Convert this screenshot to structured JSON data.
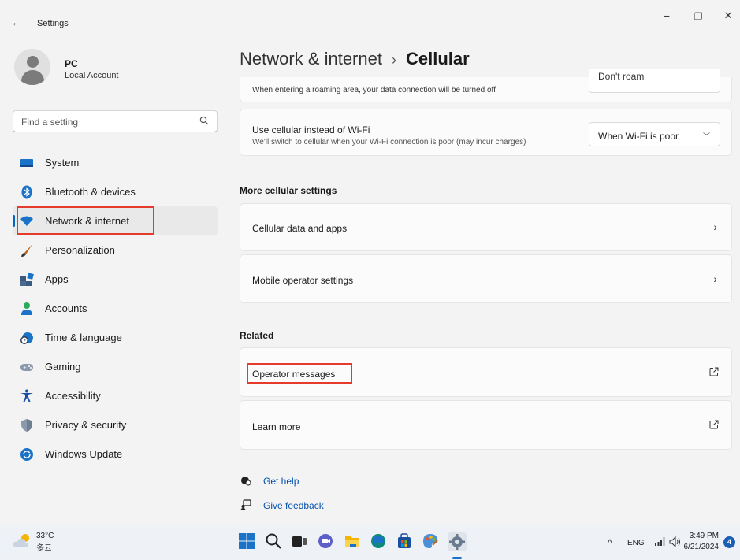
{
  "window": {
    "title": "Settings",
    "back_glyph": "←",
    "minimize_glyph": "−",
    "restore_glyph": "❐",
    "close_glyph": "✕"
  },
  "user": {
    "name": "PC",
    "account_type": "Local Account"
  },
  "search": {
    "placeholder": "Find a setting"
  },
  "sidebar": {
    "items": [
      {
        "label": "System",
        "icon": "system-icon"
      },
      {
        "label": "Bluetooth & devices",
        "icon": "bluetooth-icon"
      },
      {
        "label": "Network & internet",
        "icon": "wifi-icon",
        "active": true
      },
      {
        "label": "Personalization",
        "icon": "brush-icon"
      },
      {
        "label": "Apps",
        "icon": "apps-icon"
      },
      {
        "label": "Accounts",
        "icon": "accounts-icon"
      },
      {
        "label": "Time & language",
        "icon": "globe-clock-icon"
      },
      {
        "label": "Gaming",
        "icon": "gamepad-icon"
      },
      {
        "label": "Accessibility",
        "icon": "accessibility-icon"
      },
      {
        "label": "Privacy & security",
        "icon": "shield-icon"
      },
      {
        "label": "Windows Update",
        "icon": "update-icon"
      }
    ]
  },
  "header": {
    "breadcrumb_parent": "Network & internet",
    "separator": "›",
    "current": "Cellular"
  },
  "roaming": {
    "description": "When entering a roaming area, your data connection will be turned off",
    "value": "Don't roam"
  },
  "cellular_wifi": {
    "label": "Use cellular instead of Wi-Fi",
    "description": "We'll switch to cellular when your Wi-Fi connection is poor (may incur charges)",
    "value": "When Wi-Fi is poor"
  },
  "more_section": {
    "title": "More cellular settings",
    "items": [
      "Cellular data and apps",
      "Mobile operator settings"
    ]
  },
  "related_section": {
    "title": "Related",
    "items": [
      "Operator messages",
      "Learn more"
    ]
  },
  "help": {
    "get_help": "Get help",
    "give_feedback": "Give feedback"
  },
  "taskbar": {
    "weather_temp": "33°C",
    "weather_condition": "多云",
    "language": "ENG",
    "time": "3:49 PM",
    "date": "6/21/2024",
    "notification_count": "4"
  },
  "colors": {
    "accent": "#0067c0",
    "highlight": "#e53b2c"
  }
}
